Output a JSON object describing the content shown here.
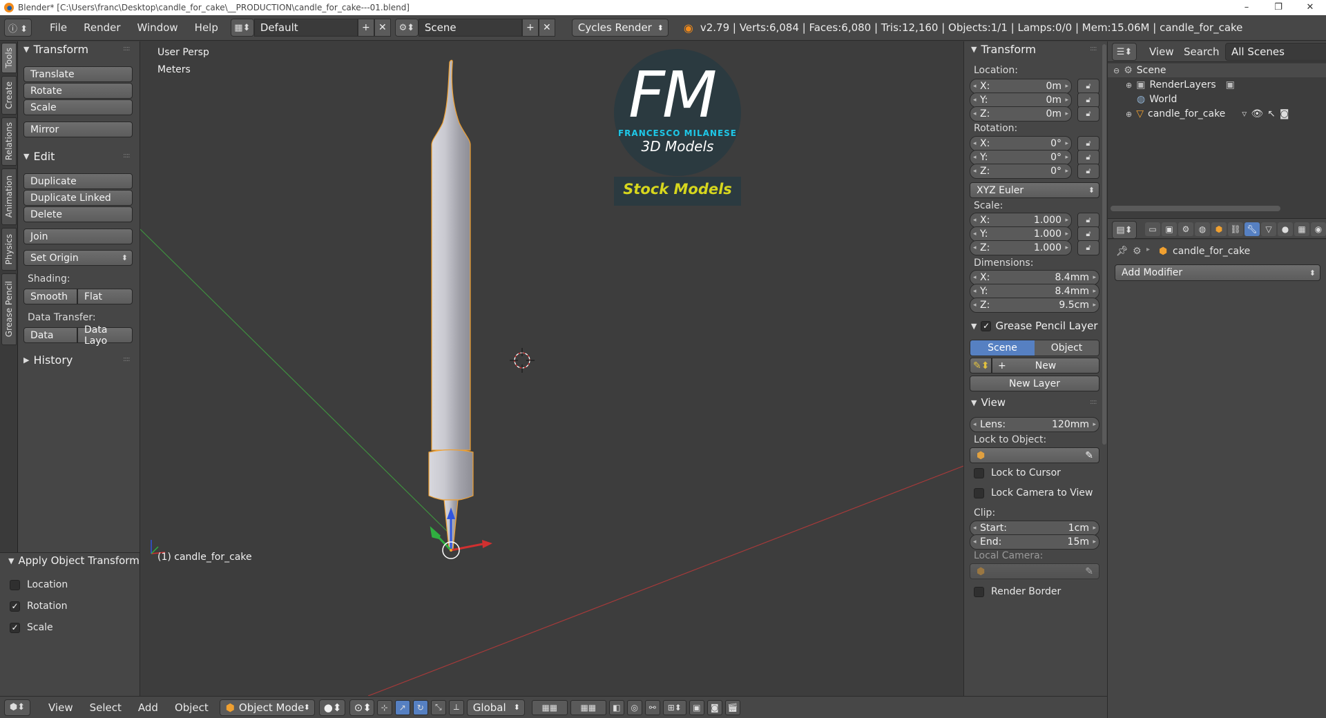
{
  "window": {
    "title": "Blender* [C:\\Users\\franc\\Desktop\\candle_for_cake\\__PRODUCTION\\candle_for_cake---01.blend]"
  },
  "top_header": {
    "menus": [
      "File",
      "Render",
      "Window",
      "Help"
    ],
    "layout": "Default",
    "scene": "Scene",
    "engine": "Cycles Render",
    "stats": "v2.79 | Verts:6,084 | Faces:6,080 | Tris:12,160 | Objects:1/1 | Lamps:0/0 | Mem:15.06M | candle_for_cake"
  },
  "tool_tabs": [
    "Tools",
    "Create",
    "Relations",
    "Animation",
    "Physics",
    "Grease Pencil"
  ],
  "tool_shelf": {
    "transform_title": "Transform",
    "translate": "Translate",
    "rotate": "Rotate",
    "scale": "Scale",
    "mirror": "Mirror",
    "edit_title": "Edit",
    "duplicate": "Duplicate",
    "duplicate_linked": "Duplicate Linked",
    "delete": "Delete",
    "join": "Join",
    "set_origin": "Set Origin",
    "shading_label": "Shading:",
    "smooth": "Smooth",
    "flat": "Flat",
    "data_transfer_label": "Data Transfer:",
    "data": "Data",
    "data_layout": "Data Layo",
    "history_title": "History"
  },
  "apply_panel": {
    "title": "Apply Object Transform",
    "location": "Location",
    "rotation": "Rotation",
    "scale": "Scale",
    "location_checked": false,
    "rotation_checked": true,
    "scale_checked": true
  },
  "viewport": {
    "view_name": "User Persp",
    "units": "Meters",
    "object_label": "(1) candle_for_cake",
    "logo_letters": "FM",
    "logo_name": "FRANCESCO MILANESE",
    "logo_sub": "3D Models",
    "logo_banner": "Stock Models"
  },
  "n_panel": {
    "transform_title": "Transform",
    "location_label": "Location:",
    "loc_x": "0m",
    "loc_y": "0m",
    "loc_z": "0m",
    "rotation_label": "Rotation:",
    "rot_x": "0°",
    "rot_y": "0°",
    "rot_z": "0°",
    "rotation_mode": "XYZ Euler",
    "scale_label": "Scale:",
    "scale_x": "1.000",
    "scale_y": "1.000",
    "scale_z": "1.000",
    "dimensions_label": "Dimensions:",
    "dim_x": "8.4mm",
    "dim_y": "8.4mm",
    "dim_z": "9.5cm",
    "x": "X:",
    "y": "Y:",
    "z": "Z:",
    "gp_title": "Grease Pencil Layer",
    "gp_scene": "Scene",
    "gp_object": "Object",
    "gp_new": "New",
    "gp_new_layer": "New Layer",
    "view_title": "View",
    "lens_label": "Lens:",
    "lens_value": "120mm",
    "lock_to_object": "Lock to Object:",
    "lock_to_cursor": "Lock to Cursor",
    "lock_camera": "Lock Camera to View",
    "clip_label": "Clip:",
    "clip_start_label": "Start:",
    "clip_start": "1cm",
    "clip_end_label": "End:",
    "clip_end": "15m",
    "local_camera": "Local Camera:",
    "render_border": "Render Border"
  },
  "outliner": {
    "view": "View",
    "search": "Search",
    "filter": "All Scenes",
    "items": [
      "Scene",
      "RenderLayers",
      "World",
      "candle_for_cake"
    ]
  },
  "properties": {
    "object_name": "candle_for_cake",
    "add_modifier": "Add Modifier"
  },
  "bottom_header": {
    "menus": [
      "View",
      "Select",
      "Add",
      "Object"
    ],
    "mode": "Object Mode",
    "orientation": "Global"
  },
  "colors": {
    "accent_blue": "#5680c2",
    "selection_orange": "#f0a030",
    "logo_cyan": "#1ec8e8",
    "logo_yellow": "#d6d61e"
  }
}
